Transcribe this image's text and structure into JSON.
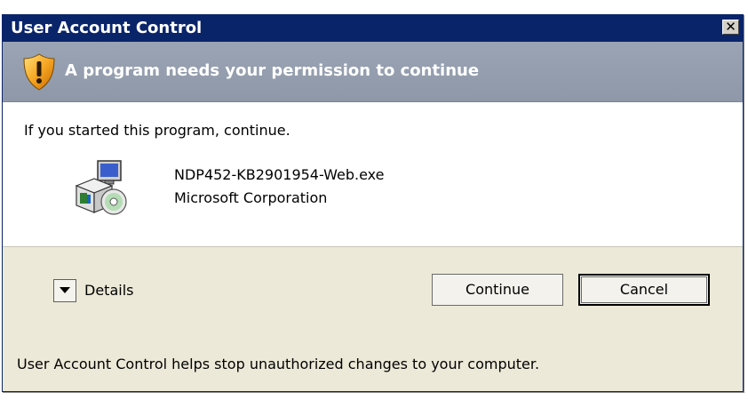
{
  "window": {
    "title": "User Account Control",
    "close_symbol": "✕"
  },
  "header": {
    "icon": "shield-warning-icon",
    "message": "A program needs your permission to continue"
  },
  "body": {
    "prompt": "If you started this program, continue.",
    "program": {
      "icon": "program-setup-icon",
      "name": "NDP452-KB2901954-Web.exe",
      "publisher": "Microsoft Corporation"
    }
  },
  "actions": {
    "details_label": "Details",
    "continue_label": "Continue",
    "cancel_label": "Cancel"
  },
  "footer": {
    "text": "User Account Control helps stop unauthorized changes to your computer."
  },
  "colors": {
    "titlebar": "#0a246a",
    "header_band": "#9aa4b4",
    "dialog_bg": "#ece9d8"
  }
}
